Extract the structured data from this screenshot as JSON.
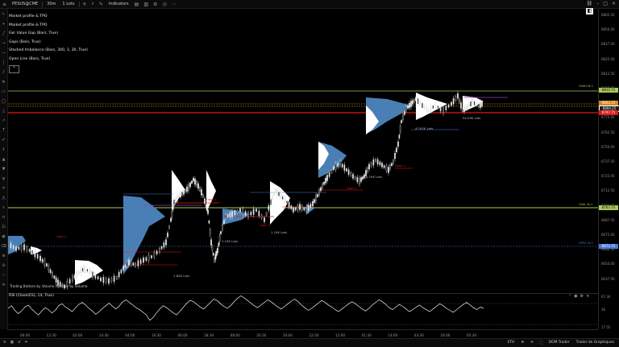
{
  "toolbar": {
    "symbol": "PESUS@CME",
    "timeframe": "30m",
    "lots": "1 Lots",
    "indicators_label": "Indicators"
  },
  "indicators": [
    "Market profile & TPO",
    "Market profile & TPO",
    "Fair Value Gap (Bars, True)",
    "Gaps (Bars, True)",
    "Stacked Imbalance (Bars, 300, 3, 30, True)",
    "Open Line (Bars, True)"
  ],
  "price_axis": [
    "6862.50",
    "6850.00",
    "6837.50",
    "6825.00",
    "6812.50",
    "6800.00",
    "6787.50",
    "6775.00",
    "6762.50",
    "6750.00",
    "6737.50",
    "6725.00",
    "6712.50",
    "6700.00",
    "6687.50",
    "6675.00",
    "6662.50",
    "6650.00",
    "6637.50"
  ],
  "price_badges": {
    "current": "6804.25",
    "vwap": "6802.25",
    "poc": "6797.75",
    "vah_label": "VVAH W-1",
    "val_label": "VVAL W-1",
    "vpoc_label": "VPOC W-1",
    "val_price": "6707.75",
    "vpoc_price": "6672.75",
    "vah_price": "6810.75"
  },
  "profile_labels": {
    "p1": "1.13K Lots",
    "p2": "1.84K Lots",
    "p3": "1.19K Lots",
    "p4": "1.19K Lots",
    "p5": "1.19K Lots",
    "p6": "47.62K Lots",
    "p7": "54.59K Lots"
  },
  "level_labels": {
    "a": "Open 1",
    "b": "Open 1",
    "c": "Open 1",
    "d": "Open 1",
    "e": "Open 1"
  },
  "trading_legend": "Trading  Bottom by Volume  Position by Volume",
  "rsi": {
    "title": "RSI (Close(ES), 14, True)",
    "axis": [
      "67.34",
      "30",
      "17.55"
    ],
    "values": [
      48,
      52,
      45,
      40,
      44,
      50,
      53,
      47,
      42,
      38,
      44,
      49,
      46,
      41,
      45,
      52,
      55,
      50,
      47,
      43,
      49,
      54,
      57,
      53,
      48,
      44,
      39,
      43,
      48,
      52,
      56,
      51,
      47,
      52,
      58,
      61,
      57,
      53,
      49,
      46,
      42,
      38,
      30,
      34,
      41,
      47,
      52,
      49,
      45,
      41,
      38,
      44,
      50,
      56,
      60,
      58,
      54,
      50,
      47,
      52,
      57,
      62,
      60,
      55,
      51,
      48,
      52,
      58,
      63,
      67,
      64,
      60,
      56,
      52,
      49,
      53,
      57,
      61,
      58,
      54,
      50,
      47,
      51,
      55,
      59,
      62,
      58,
      53,
      49,
      45,
      48,
      52,
      56,
      60,
      57,
      53,
      50,
      46,
      43,
      47,
      51,
      55,
      58,
      55,
      51,
      47,
      44,
      48,
      53,
      57,
      61,
      58,
      54,
      49,
      46,
      50,
      54,
      51,
      47,
      43,
      46,
      50,
      53,
      49,
      46,
      43,
      47,
      51,
      55,
      52,
      48,
      45,
      42,
      46,
      50,
      54,
      57,
      53,
      49,
      46,
      50,
      48
    ]
  },
  "time_axis": [
    "00:00",
    "12:30",
    "02:00",
    "14:30",
    "04:00",
    "16:30",
    "06:00",
    "18:30",
    "08:00",
    "20:30",
    "10:00",
    "22:30",
    "12:00",
    "01:30",
    "14:00",
    "03:30",
    "16:00",
    "05:30"
  ],
  "statusbar": {
    "session": "ETH",
    "dom": "DOM Trader",
    "chart_trader": "Trader de Graphiques"
  },
  "colors": {
    "profile_fill": "#4a7fb5",
    "profile_white": "#ffffff",
    "poc_line": "#e01b1b",
    "val_line": "#a7c957",
    "vpoc_line": "#4a78d8",
    "candle": "#e6e6e6"
  }
}
